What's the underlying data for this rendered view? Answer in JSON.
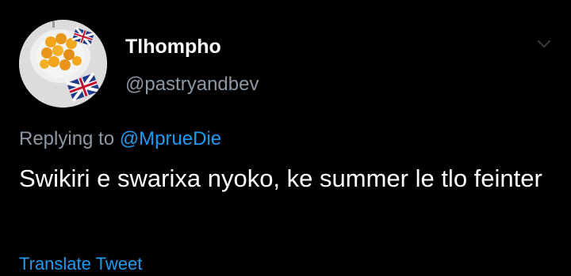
{
  "author": {
    "display_name": "Tlhompho",
    "handle": "@pastryandbev",
    "avatar_icon": "profile-photo-pastries-and-flag"
  },
  "menu_icon": "chevron-down-icon",
  "reply": {
    "prefix": "Replying to ",
    "mention": "@MprueDie"
  },
  "tweet": {
    "text": "Swikiri e swarixa nyoko, ke summer le tlo feinter"
  },
  "translate_label": "Translate Tweet",
  "colors": {
    "background": "#000000",
    "text": "#ffffff",
    "secondary_text": "#8b98a5",
    "link": "#1d9bf0"
  }
}
